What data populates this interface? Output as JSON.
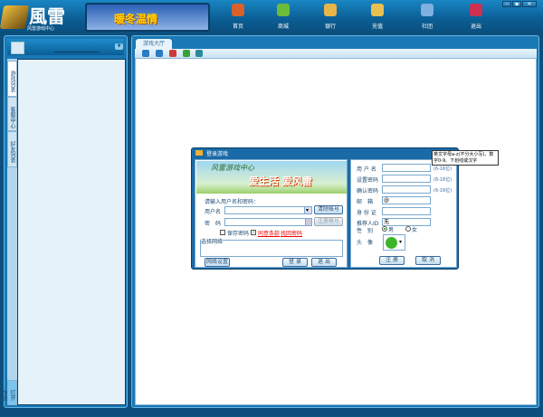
{
  "header": {
    "logo_text": "風雷",
    "logo_sub": "风雷游戏中心",
    "banner_text": "暖冬温情",
    "nav": [
      {
        "label": "首页",
        "icon": "home-icon",
        "color": "#d9602a"
      },
      {
        "label": "商城",
        "icon": "shop-icon",
        "color": "#6dbb3a"
      },
      {
        "label": "银行",
        "icon": "bank-icon",
        "color": "#e8b54a"
      },
      {
        "label": "充值",
        "icon": "recharge-icon",
        "color": "#e8c050"
      },
      {
        "label": "社团",
        "icon": "group-icon",
        "color": "#7fb0e0"
      },
      {
        "label": "退出",
        "icon": "exit-icon",
        "color": "#d03050"
      }
    ],
    "window_controls": [
      "–",
      "▪",
      "×"
    ]
  },
  "left": {
    "tabs": [
      "游戏列表",
      "客服中心",
      "好友列表"
    ],
    "bottom_tab": "打开存盘"
  },
  "right": {
    "tab": "游戏大厅",
    "toolbar": [
      "back-icon",
      "forward-icon",
      "stop-icon",
      "refresh-icon",
      "home-icon"
    ]
  },
  "dialog": {
    "title": "登录游戏",
    "banner_title": "风雷游戏中心",
    "banner_slogan": "爱生活 爱风雷",
    "prompt": "请输入用户名和密码：",
    "username_label": "用户名",
    "password_label": "密　码",
    "clear_account": "清除帐号",
    "register_account": "注册帐号",
    "save_password": "保存密码",
    "save_password_checked": false,
    "agree": "同意条款",
    "agree_checked": true,
    "find_password": "找回密码",
    "network_label": "选择网络",
    "network_settings": "网络设置",
    "login": "登 录",
    "exit": "退 出",
    "reg": {
      "fields": [
        {
          "label": "用 户 名",
          "value": "",
          "hint": "(6-16位)"
        },
        {
          "label": "设置密码",
          "value": "",
          "hint": "(6-16位)"
        },
        {
          "label": "确认密码",
          "value": "",
          "hint": "(6-16位)"
        },
        {
          "label": "邮　箱",
          "value": "@",
          "hint": ""
        },
        {
          "label": "身 份 证",
          "value": "",
          "hint": ""
        },
        {
          "label": "推荐人ID",
          "value": "无",
          "hint": ""
        }
      ],
      "gender_label": "性　别",
      "male": "男",
      "female": "女",
      "gender_selected": "男",
      "avatar_label": "头　像",
      "register": "注 册",
      "cancel": "取 消"
    },
    "tooltip": "英文字母a-z(不分大小写)、数字0-9、下划线或汉字"
  }
}
